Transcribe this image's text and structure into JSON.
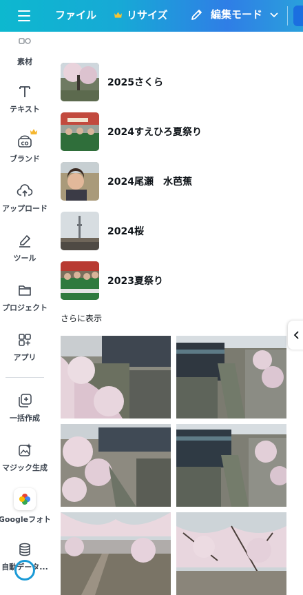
{
  "topbar": {
    "file_label": "ファイル",
    "resize_label": "リサイズ",
    "edit_mode_label": "編集モード",
    "brand_color": "#17a9d6"
  },
  "sidebar": {
    "items": [
      {
        "label": "素材",
        "icon": "elements-icon"
      },
      {
        "label": "テキスト",
        "icon": "text-icon"
      },
      {
        "label": "ブランド",
        "icon": "brand-icon"
      },
      {
        "label": "アップロード",
        "icon": "upload-cloud-icon"
      },
      {
        "label": "ツール",
        "icon": "draw-tool-icon"
      },
      {
        "label": "プロジェクト",
        "icon": "folder-icon"
      },
      {
        "label": "アプリ",
        "icon": "apps-icon"
      },
      {
        "label": "一括作成",
        "icon": "bulk-create-icon"
      },
      {
        "label": "マジック生成",
        "icon": "magic-generate-icon"
      },
      {
        "label": "Googleフォト",
        "icon": "google-photos-icon"
      },
      {
        "label": "自動データ...",
        "icon": "database-icon"
      }
    ]
  },
  "panel": {
    "folders": [
      {
        "name": "2025さくら",
        "thumb": "cherry-blossom-tree"
      },
      {
        "name": "2024すえひろ夏祭り",
        "thumb": "festival-crowd"
      },
      {
        "name": "2024尾瀬　水芭蕉",
        "thumb": "portrait-selfie"
      },
      {
        "name": "2024桜",
        "thumb": "skytree-cityscape"
      },
      {
        "name": "2023夏祭り",
        "thumb": "festival-group"
      }
    ],
    "more_label": "さらに表示",
    "photos": [
      {
        "subject": "cherry blossoms along canal, view 1"
      },
      {
        "subject": "canal with elevated railway, view 1"
      },
      {
        "subject": "cherry blossoms along canal, view 2"
      },
      {
        "subject": "canal with elevated railway, view 2"
      },
      {
        "subject": "cherry blossom path"
      },
      {
        "subject": "cherry blossom branches"
      }
    ]
  }
}
